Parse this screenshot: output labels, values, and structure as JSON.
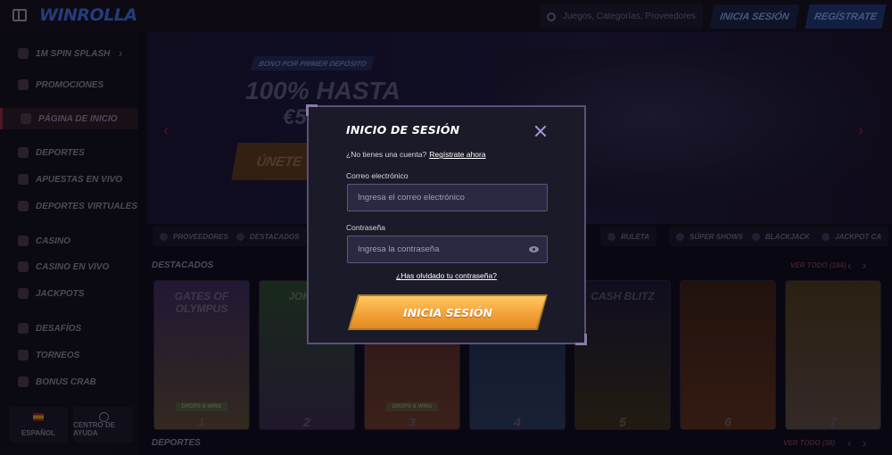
{
  "topbar": {
    "logo_text": "WINROLLA",
    "search_placeholder": "Juegos, Categorías, Proveedores",
    "login_label": "INICIA SESIÓN",
    "register_label": "REGÍSTRATE"
  },
  "sidebar": {
    "items": [
      {
        "label": "1M SPIN SPLASH",
        "icon": "trophy-icon"
      },
      {
        "label": "PROMOCIONES",
        "icon": "gift-icon"
      },
      {
        "label": "PÁGINA DE INICIO",
        "icon": "home-icon"
      },
      {
        "label": "DEPORTES",
        "icon": "ball-icon"
      },
      {
        "label": "APUESTAS EN VIVO",
        "icon": "live-icon"
      },
      {
        "label": "DEPORTES VIRTUALES",
        "icon": "virtual-icon"
      },
      {
        "label": "CASINO",
        "icon": "casino-icon"
      },
      {
        "label": "CASINO EN VIVO",
        "icon": "cards-icon"
      },
      {
        "label": "JACKPOTS",
        "icon": "jackpot-icon"
      },
      {
        "label": "DESAFÍOS",
        "icon": "challenge-icon"
      },
      {
        "label": "TORNEOS",
        "icon": "tournament-icon"
      },
      {
        "label": "BONUS CRAB",
        "icon": "crab-icon"
      }
    ],
    "language_label": "ESPAÑOL",
    "help_label": "CENTRO DE AYUDA"
  },
  "banner": {
    "badge": "BONO POR PRIMER DEPÓSITO",
    "headline": "100% HASTA",
    "amount": "€5",
    "cta": "ÚNETE"
  },
  "categories": [
    {
      "label": "PROVEEDORES"
    },
    {
      "label": "DESTACADOS"
    },
    {
      "label": "RULETA"
    },
    {
      "label": "SÚPER SHOWS"
    },
    {
      "label": "BLACKJACK"
    },
    {
      "label": "JACKPOT CA"
    }
  ],
  "featured": {
    "title": "DESTACADOS",
    "see_all": "VER TODO (184)",
    "games": [
      {
        "name": "GATES OF OLYMPUS",
        "rank": "1",
        "tag": "DROPS & WINS"
      },
      {
        "name": "JOKER",
        "rank": "2",
        "tag": ""
      },
      {
        "name": "",
        "rank": "3",
        "tag": "DROPS & WINS"
      },
      {
        "name": "",
        "rank": "4",
        "tag": ""
      },
      {
        "name": "CASH BLITZ",
        "rank": "5",
        "tag": ""
      },
      {
        "name": "",
        "rank": "6",
        "tag": ""
      },
      {
        "name": "",
        "rank": "7",
        "tag": ""
      }
    ]
  },
  "sports_section": {
    "title": "DEPORTES",
    "see_all": "VER TODO (38)"
  },
  "modal": {
    "title": "INICIO DE SESIÓN",
    "no_account_text": "¿No tienes una cuenta?",
    "register_link": "Regístrate ahora",
    "email_label": "Correo electrónico",
    "email_placeholder": "Ingresa el correo electrónico",
    "email_value": "",
    "password_label": "Contraseña",
    "password_placeholder": "Ingresa la contraseña",
    "password_value": "",
    "forgot_link": "¿Has olvidado tu contraseña?",
    "submit_label": "INICIA SESIÓN"
  },
  "colors": {
    "background": "#0e0c16",
    "modal_bg": "#1b1a28",
    "modal_border": "#5a5078",
    "button_gradient_top": "#ffc861",
    "button_gradient_bottom": "#e48a22",
    "field_bg": "#2b2842"
  }
}
